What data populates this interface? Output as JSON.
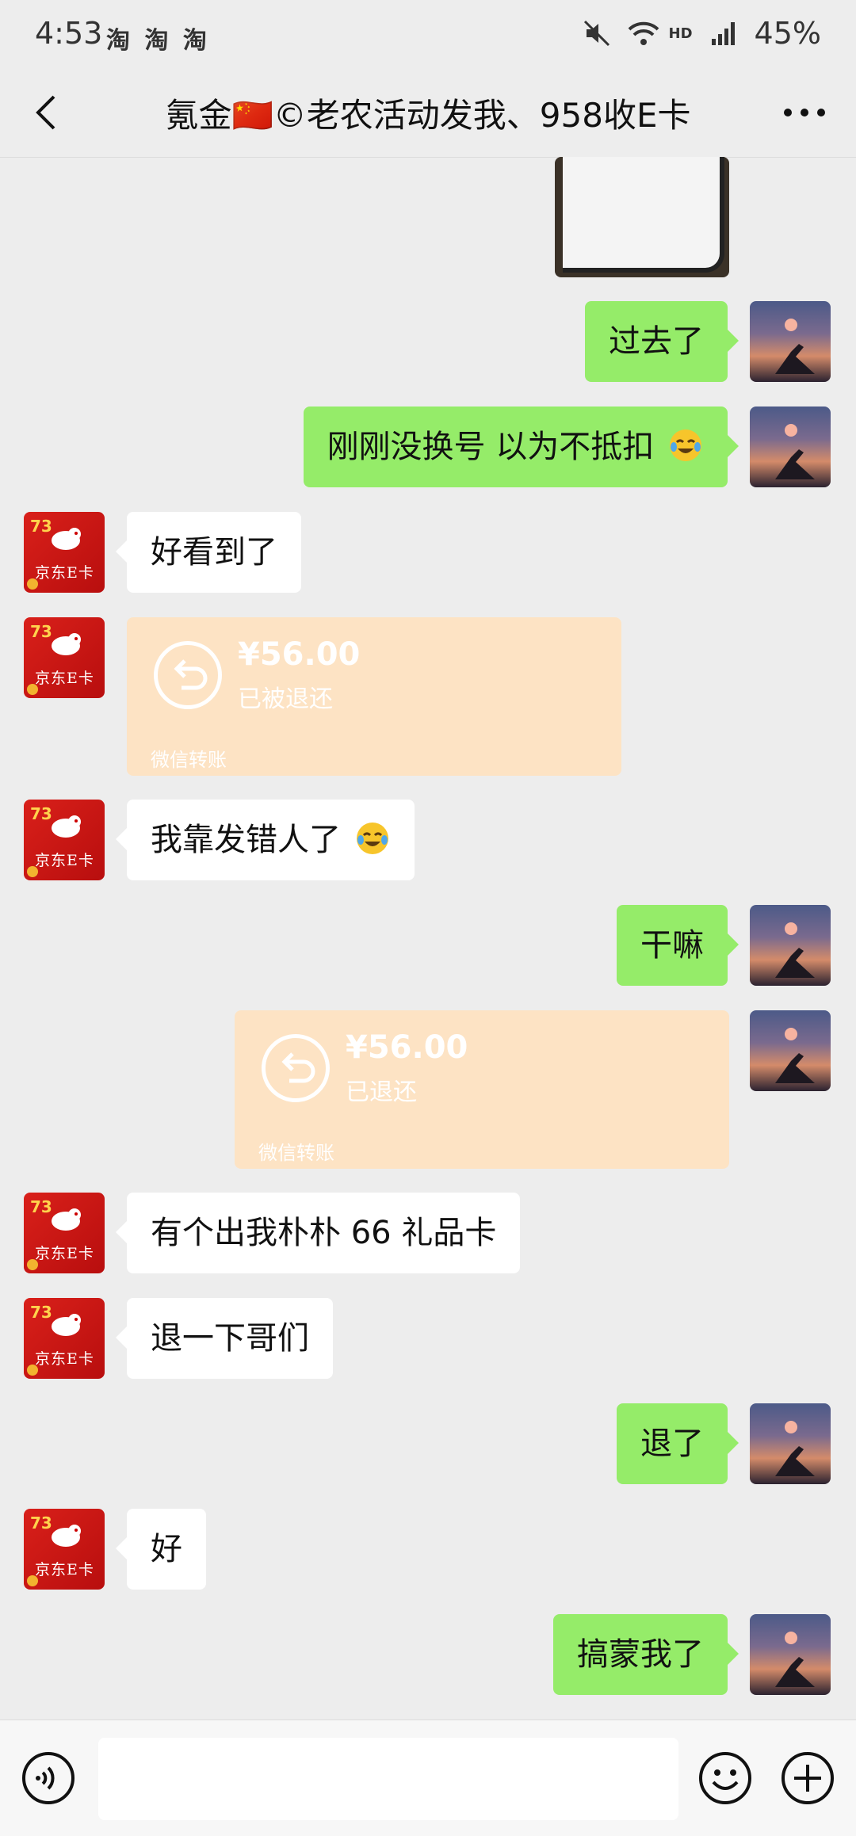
{
  "status": {
    "time": "4:53",
    "apps": "淘 淘 淘",
    "network": "HD",
    "battery": "45%"
  },
  "header": {
    "title": "氪金🇨🇳©老农活动发我、958收E卡"
  },
  "avatars": {
    "contact_line1": "73",
    "contact_line2": "京东E卡"
  },
  "messages": {
    "m1": "过去了",
    "m2": "刚刚没换号 以为不抵扣",
    "m3": "好看到了",
    "t1": {
      "amount": "¥56.00",
      "status": "已被退还",
      "footer": "微信转账"
    },
    "m4": "我靠发错人了",
    "m5": "干嘛",
    "t2": {
      "amount": "¥56.00",
      "status": "已退还",
      "footer": "微信转账"
    },
    "m6": "有个出我朴朴 66 礼品卡",
    "m7": "退一下哥们",
    "m8": "退了",
    "m9": "好",
    "m10": "搞蒙我了"
  },
  "input": {
    "placeholder": ""
  },
  "colors": {
    "outgoing": "#95ec69",
    "incoming": "#ffffff",
    "transfer": "#fde3c4",
    "background": "#ededed"
  }
}
